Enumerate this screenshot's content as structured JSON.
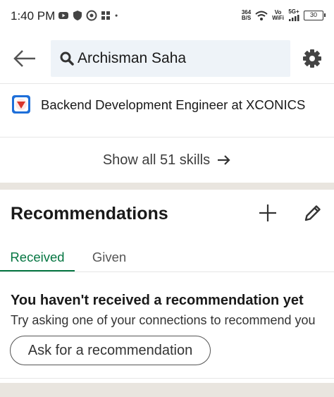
{
  "status_bar": {
    "time": "1:40 PM",
    "net_speed_value": "364",
    "net_speed_unit": "B/S",
    "volte_top": "Vo",
    "volte_bottom": "WiFi",
    "signal_label": "5G+",
    "battery": "30",
    "icons": [
      "youtube-icon",
      "shield-icon",
      "whatsapp-icon",
      "grid-icon",
      "dot-icon",
      "wifi-icon",
      "signal-icon",
      "battery-icon"
    ]
  },
  "header": {
    "search_value": "Archisman Saha",
    "icons": [
      "back-arrow-icon",
      "search-icon",
      "gear-icon"
    ]
  },
  "experience": {
    "text": "Backend Development Engineer at XCONICS"
  },
  "skills": {
    "show_all_label": "Show all 51 skills"
  },
  "recommendations": {
    "title": "Recommendations",
    "tabs": [
      {
        "label": "Received",
        "active": true
      },
      {
        "label": "Given",
        "active": false
      }
    ],
    "empty_title": "You haven't received a recommendation yet",
    "empty_subtitle": "Try asking one of your connections to recommend you",
    "ask_button": "Ask for a recommendation"
  },
  "colors": {
    "accent_green": "#057642",
    "search_bg": "#eef3f8",
    "section_gap": "#e9e5df",
    "logo_blue": "#1e6fd9",
    "logo_red": "#d9342b"
  }
}
